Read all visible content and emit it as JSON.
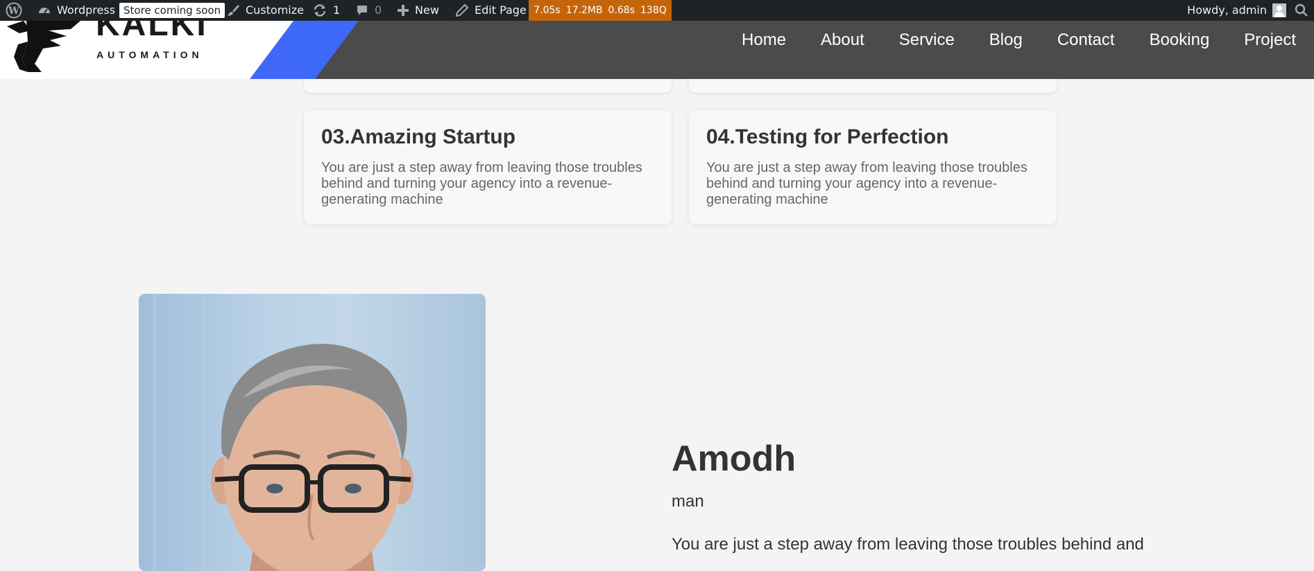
{
  "adminbar": {
    "site_name": "Wordpress",
    "store_badge": "Store coming soon",
    "customize": "Customize",
    "updates_count": "1",
    "comments_count": "0",
    "new_label": "New",
    "edit_page": "Edit Page",
    "query_monitor": {
      "time": "7.05s",
      "memory": "17.2MB",
      "db_time": "0.68s",
      "queries": "138Q"
    },
    "howdy": "Howdy, admin"
  },
  "header": {
    "logo_word": "KALKI",
    "logo_sub": "AUTOMATION",
    "nav": [
      "Home",
      "About",
      "Service",
      "Blog",
      "Contact",
      "Booking",
      "Project"
    ]
  },
  "steps": [
    {
      "title": "03.Amazing Startup",
      "text": "You are just a step away from leaving those troubles behind and turning your agency into a revenue-generating machine"
    },
    {
      "title": "04.Testing for Perfection",
      "text": "You are just a step away from leaving those troubles behind and turning your agency into a revenue-generating machine"
    }
  ],
  "member": {
    "name": "Amodh",
    "role": "man",
    "bio": "You are just a step away from leaving those troubles behind and"
  },
  "colors": {
    "adminbar_bg": "#1d2327",
    "query_monitor_bg": "#c5650a",
    "header_bg": "#4b4b4b",
    "logo_accent": "#3e68f7",
    "page_bg": "#f4f4f4"
  }
}
